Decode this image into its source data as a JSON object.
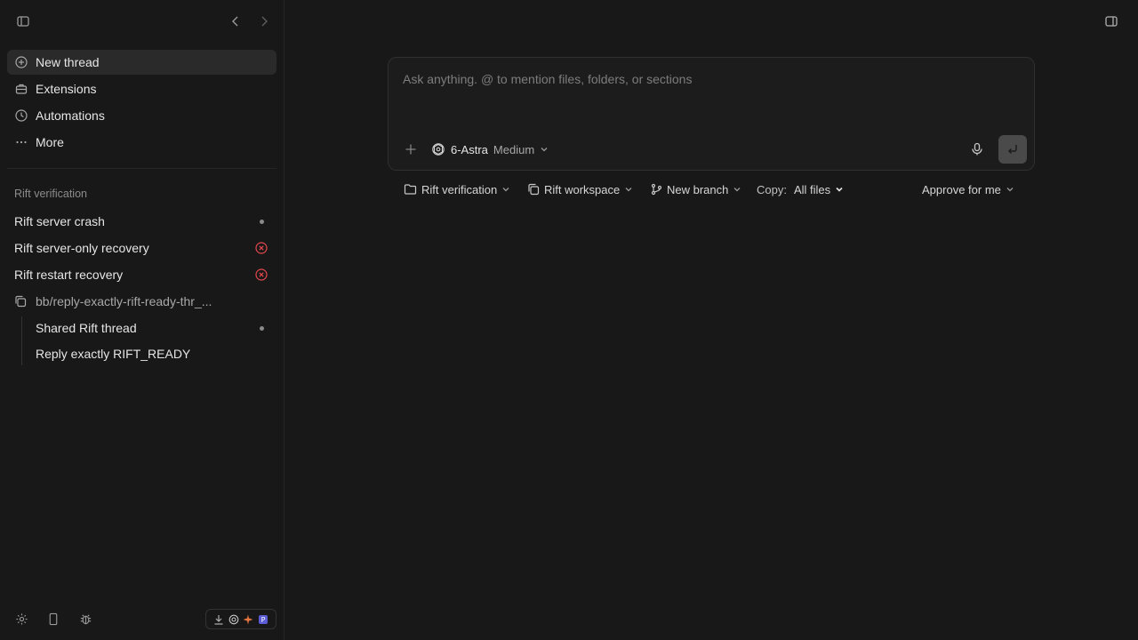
{
  "sidebar": {
    "nav": [
      {
        "label": "New thread",
        "icon": "plus-circle-icon",
        "active": true
      },
      {
        "label": "Extensions",
        "icon": "briefcase-icon",
        "active": false
      },
      {
        "label": "Automations",
        "icon": "clock-icon",
        "active": false
      },
      {
        "label": "More",
        "icon": "ellipsis-icon",
        "active": false
      }
    ],
    "section_label": "Rift verification",
    "threads": [
      {
        "label": "Rift server crash",
        "status": "dot"
      },
      {
        "label": "Rift server-only recovery",
        "status": "error"
      },
      {
        "label": "Rift restart recovery",
        "status": "error"
      }
    ],
    "worktree": {
      "label": "bb/reply-exactly-rift-ready-thr_...",
      "children": [
        {
          "label": "Shared Rift thread",
          "status": "dot"
        },
        {
          "label": "Reply exactly RIFT_READY",
          "status": ""
        }
      ]
    }
  },
  "composer": {
    "placeholder": "Ask anything. @ to mention files, folders, or sections",
    "model_name": "6-Astra",
    "model_effort": "Medium"
  },
  "toolbar": {
    "project": "Rift verification",
    "workspace": "Rift workspace",
    "branch": "New branch",
    "copy_label": "Copy:",
    "copy_value": "All files",
    "approval": "Approve for me"
  },
  "colors": {
    "background": "#181818",
    "error": "#e5484d",
    "active_item": "#2a2a2a"
  }
}
